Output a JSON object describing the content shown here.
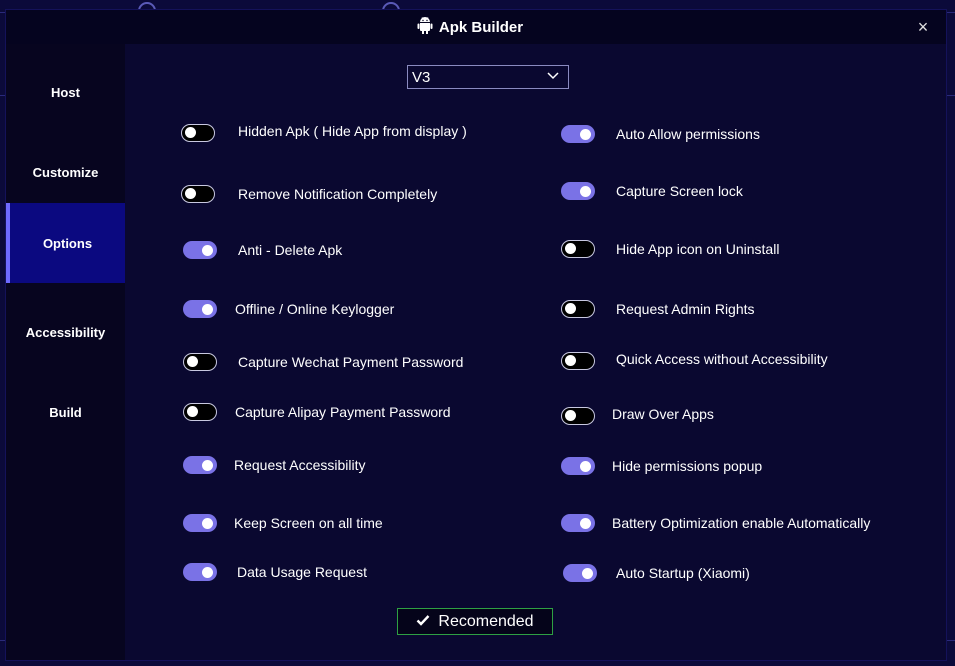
{
  "window": {
    "title": "Apk Builder",
    "close_glyph": "×"
  },
  "sidebar": {
    "items": [
      {
        "label": "Host",
        "active": false
      },
      {
        "label": "Customize",
        "active": false
      },
      {
        "label": "Options",
        "active": true
      },
      {
        "label": "Accessibility",
        "active": false
      },
      {
        "label": "Build",
        "active": false
      }
    ]
  },
  "version_select": {
    "value": "V3"
  },
  "options_left": [
    {
      "label": "Hidden  Apk ( Hide App from display )",
      "on": false
    },
    {
      "label": "Remove Notification Completely",
      "on": false
    },
    {
      "label": "Anti - Delete Apk",
      "on": true
    },
    {
      "label": "Offline / Online Keylogger",
      "on": true
    },
    {
      "label": "Capture Wechat Payment Password",
      "on": false
    },
    {
      "label": "Capture Alipay Payment Password",
      "on": false
    },
    {
      "label": "Request Accessibility",
      "on": true
    },
    {
      "label": "Keep Screen on all time",
      "on": true
    },
    {
      "label": "Data Usage Request",
      "on": true
    }
  ],
  "options_right": [
    {
      "label": "Auto Allow permissions",
      "on": true
    },
    {
      "label": "Capture Screen lock",
      "on": true
    },
    {
      "label": "Hide App icon on Uninstall",
      "on": false
    },
    {
      "label": "Request Admin Rights",
      "on": false
    },
    {
      "label": "Quick Access without Accessibility",
      "on": false
    },
    {
      "label": "Draw Over Apps",
      "on": false
    },
    {
      "label": "Hide permissions popup",
      "on": true
    },
    {
      "label": "Battery Optimization enable Automatically",
      "on": true
    },
    {
      "label": "Auto Startup (Xiaomi)",
      "on": true
    }
  ],
  "recommended_button": {
    "label": "Recomended",
    "icon": "check-icon"
  },
  "colors": {
    "toggle_on": "#7a72e6",
    "active_nav": "#0b0980",
    "button_border": "#2ea043"
  }
}
